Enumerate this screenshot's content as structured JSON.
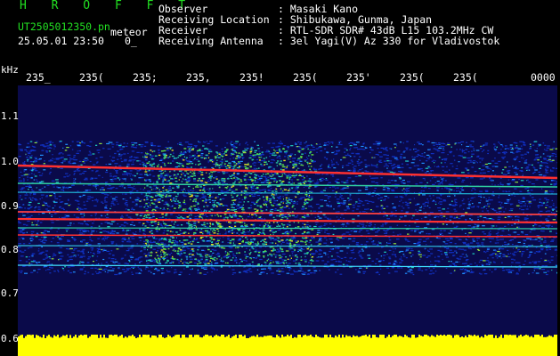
{
  "header": {
    "app_title": "H R O F F T",
    "file_name": "UT2505012350.pn",
    "file_tag": "meteor",
    "date_time": "25.05.01 23:50",
    "count": "0_"
  },
  "info": [
    {
      "label": "Observer",
      "value": ": Masaki Kano"
    },
    {
      "label": "Receiving Location",
      "value": ": Shibukawa, Gunma, Japan"
    },
    {
      "label": "Receiver",
      "value": ": RTL-SDR SDR# 43dB L15 103.2MHz CW"
    },
    {
      "label": "Receiving Antenna",
      "value": ": 3el Yagi(V) Az 330 for Vladivostok"
    }
  ],
  "axis": {
    "unit": "kHz",
    "time_ticks": [
      "235_",
      "235(",
      "235;",
      "235,",
      "235!",
      "235(",
      "235'",
      "235(",
      "235(",
      "0000"
    ],
    "freq_ticks": [
      "1.1",
      "1.0",
      "0.9",
      "0.8",
      "0.7",
      "0.6"
    ]
  },
  "colors": {
    "background": "#0a0a4a",
    "text_green": "#22e022",
    "text_white": "#ffffff",
    "signal_yellow": "#ffff00",
    "echo_red": "#ff3030"
  }
}
